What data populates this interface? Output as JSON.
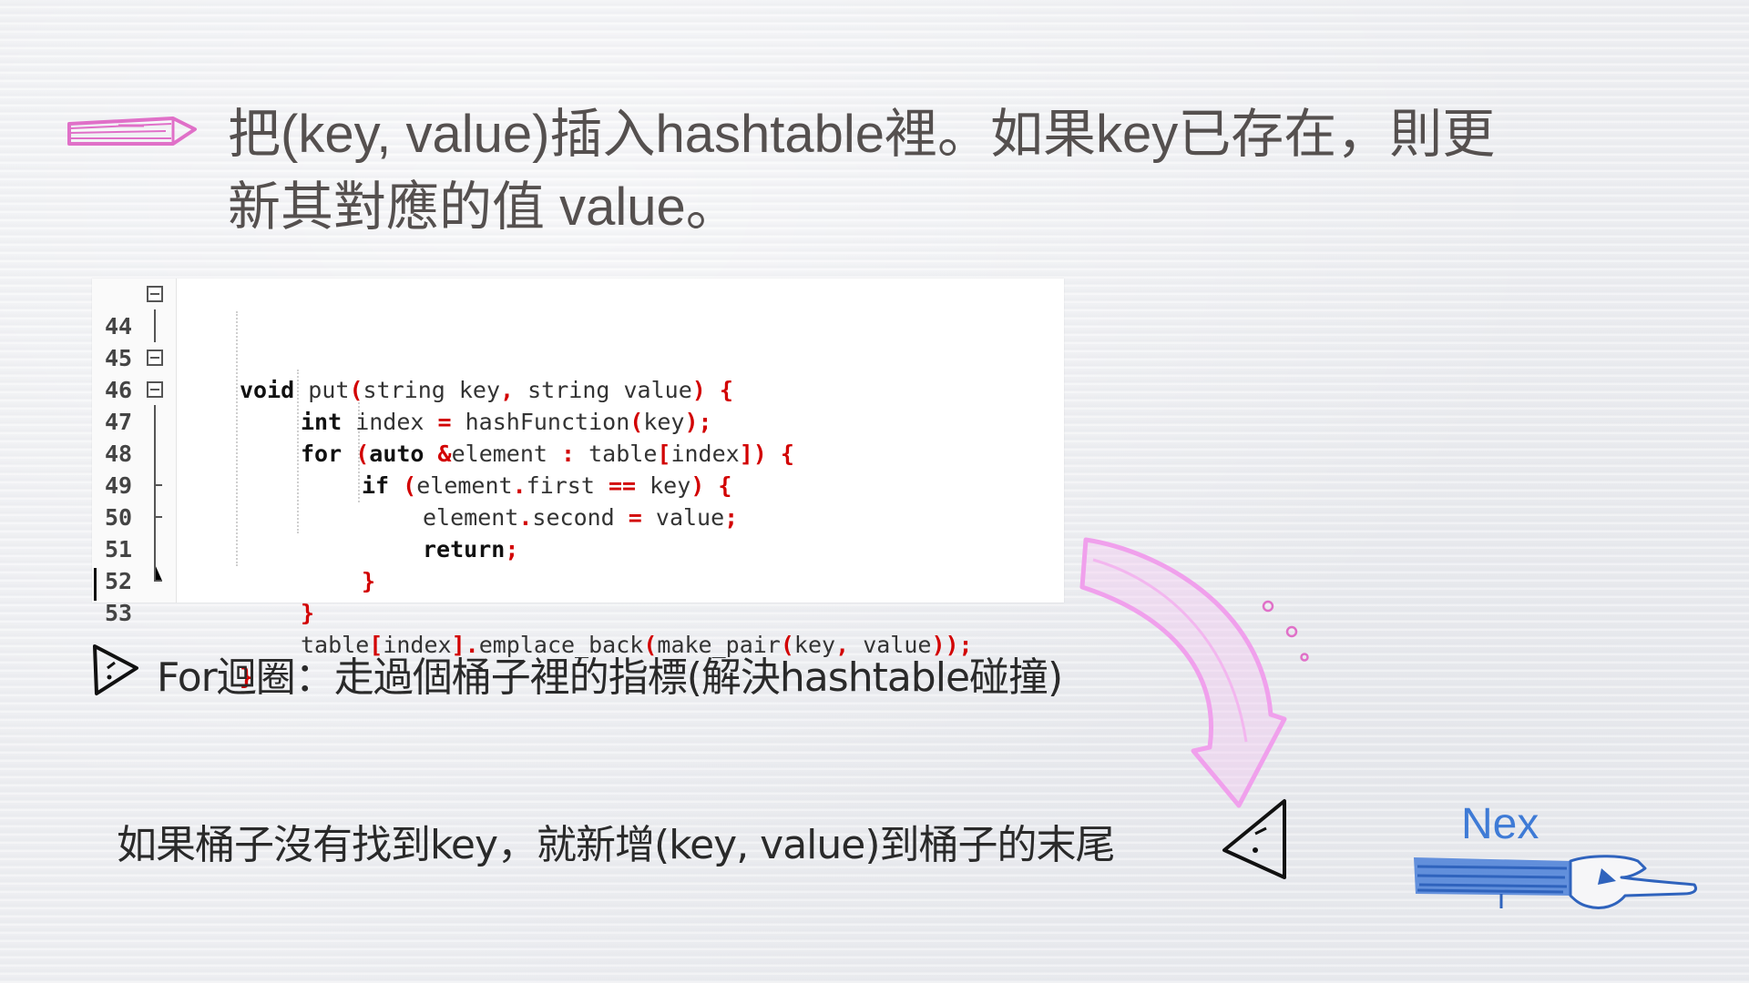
{
  "slide": {
    "title": "把(key, value)插入hashtable裡。如果key已存在，則更\n新其對應的值 value。"
  },
  "code": {
    "lines": [
      {
        "num": "44",
        "fold": "minus"
      },
      {
        "num": "45",
        "fold": "line"
      },
      {
        "num": "46",
        "fold": "minus"
      },
      {
        "num": "47",
        "fold": "minus"
      },
      {
        "num": "48",
        "fold": "line"
      },
      {
        "num": "49",
        "fold": "line"
      },
      {
        "num": "50",
        "fold": "tee"
      },
      {
        "num": "51",
        "fold": "tee"
      },
      {
        "num": "52",
        "fold": "line"
      },
      {
        "num": "53",
        "fold": "tee"
      }
    ],
    "tokens": {
      "void": "void",
      "put_sig": " put",
      "p44_open": "(",
      "p44_args": "string key",
      "comma": ",",
      "p44_args2": " string value",
      "p44_close": ")",
      "brace_open": " {",
      "int": "int",
      "index_decl": " index ",
      "eq": "=",
      "hash_call": " hashFunction",
      "paren_open": "(",
      "key": "key",
      "paren_close_semi": ");",
      "for": "for",
      "sp_paren": " (",
      "auto": "auto",
      "amp": " &",
      "element_for": "element ",
      "colon": ":",
      "table_sp": " table",
      "bracket_open": "[",
      "index": "index",
      "bracket_close_paren": "])",
      "if": "if",
      "element_first": "element",
      "dot": ".",
      "first": "first ",
      "eqeq": "==",
      "key_sp": " key",
      "close_paren_brace": ") {",
      "element_second": "element",
      "second": "second ",
      "value": " value",
      "semi": ";",
      "return": "return",
      "close_brace": "}",
      "table": "table",
      "emplace": "emplace_back",
      "make_pair": "make_pair",
      "key2": "key",
      "value2": " value",
      "closing": "));"
    }
  },
  "notes": {
    "for_loop": "For迴圈：走過個桶子裡的指標(解決hashtable碰撞)",
    "append": "如果桶子沒有找到key，就新增(key, value)到桶子的末尾"
  },
  "nav": {
    "next_label": "Nex"
  },
  "colors": {
    "title": "#55504f",
    "accent_pink": "#e070c8",
    "arrow_pink": "#f0a0ec",
    "nav_blue": "#3f7bd6",
    "code_punct": "#d20000"
  },
  "icons": {
    "pencil": "pencil-icon",
    "play_triangle": "triangle-bullet-icon",
    "warning_triangle": "triangle-bullet-icon-2",
    "curved_arrow": "curved-arrow-icon",
    "pointing_hand": "pointing-hand-icon"
  }
}
